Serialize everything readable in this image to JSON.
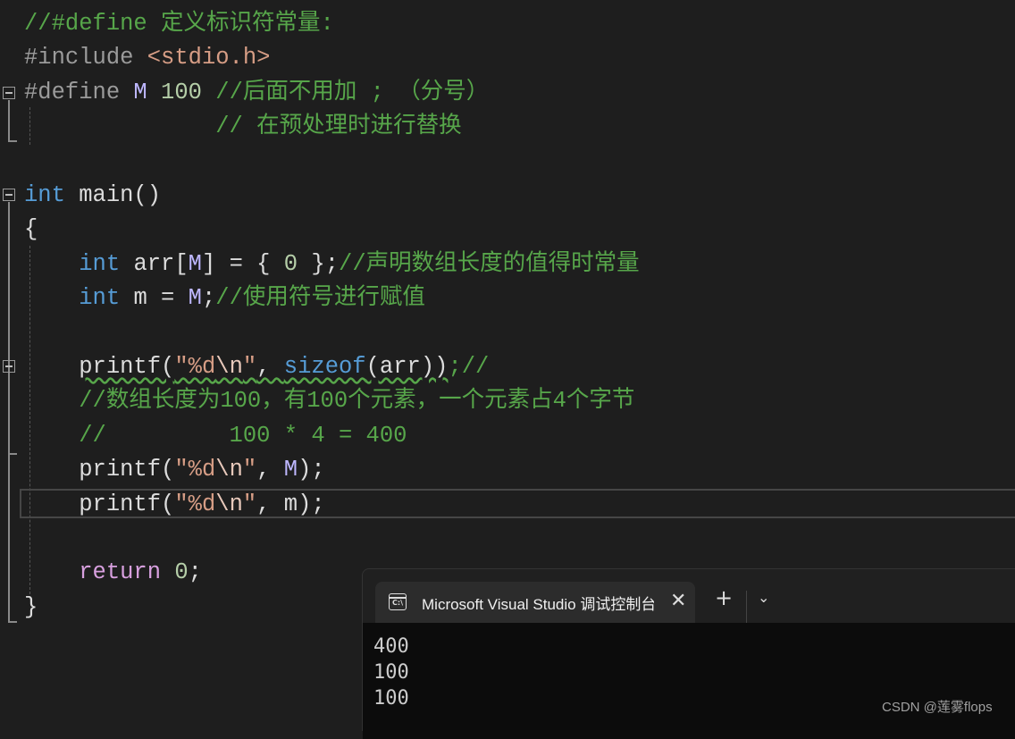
{
  "code_lines": [
    [
      {
        "text": "//#define 定义标识符常量:",
        "type": "comment"
      }
    ],
    [
      {
        "text": "#include ",
        "type": "pre"
      },
      {
        "text": "<stdio.h>",
        "type": "str"
      }
    ],
    [
      {
        "text": "#define ",
        "type": "pre"
      },
      {
        "text": "M",
        "type": "macro"
      },
      {
        "text": " ",
        "type": "plain"
      },
      {
        "text": "100",
        "type": "num"
      },
      {
        "text": " //后面不用加 ; （分号）",
        "type": "comment"
      }
    ],
    [
      {
        "text": "              // 在预处理时进行替换",
        "type": "comment"
      }
    ],
    [],
    [
      {
        "text": "int",
        "type": "kw"
      },
      {
        "text": " main()",
        "type": "plain"
      }
    ],
    [
      {
        "text": "{",
        "type": "plain"
      }
    ],
    [
      {
        "text": "    ",
        "type": "plain"
      },
      {
        "text": "int",
        "type": "kw"
      },
      {
        "text": " arr[",
        "type": "plain"
      },
      {
        "text": "M",
        "type": "macro"
      },
      {
        "text": "] = { ",
        "type": "plain"
      },
      {
        "text": "0",
        "type": "num"
      },
      {
        "text": " };",
        "type": "plain"
      },
      {
        "text": "//声明数组长度的值得时常量",
        "type": "comment"
      }
    ],
    [
      {
        "text": "    ",
        "type": "plain"
      },
      {
        "text": "int",
        "type": "kw"
      },
      {
        "text": " m = ",
        "type": "plain"
      },
      {
        "text": "M",
        "type": "macro"
      },
      {
        "text": ";",
        "type": "plain"
      },
      {
        "text": "//使用符号进行赋值",
        "type": "comment"
      }
    ],
    [],
    [
      {
        "text": "    ",
        "type": "plain"
      },
      {
        "text": "printf(",
        "type": "fn",
        "squiggle": true
      },
      {
        "text": "\"%d",
        "type": "str",
        "squiggle": true
      },
      {
        "text": "\\n",
        "type": "esc",
        "squiggle": true
      },
      {
        "text": "\"",
        "type": "str",
        "squiggle": true
      },
      {
        "text": ", ",
        "type": "plain",
        "squiggle": true
      },
      {
        "text": "sizeof",
        "type": "kw",
        "squiggle": true
      },
      {
        "text": "(arr))",
        "type": "plain",
        "squiggle": true
      },
      {
        "text": ";//",
        "type": "comment"
      }
    ],
    [
      {
        "text": "    //数组长度为100，有100个元素，一个元素占4个字节",
        "type": "comment"
      }
    ],
    [
      {
        "text": "    //         100 * 4 = 400",
        "type": "comment"
      }
    ],
    [
      {
        "text": "    ",
        "type": "plain"
      },
      {
        "text": "printf(",
        "type": "fn"
      },
      {
        "text": "\"%d",
        "type": "str"
      },
      {
        "text": "\\n",
        "type": "esc"
      },
      {
        "text": "\"",
        "type": "str"
      },
      {
        "text": ", ",
        "type": "plain"
      },
      {
        "text": "M",
        "type": "macro"
      },
      {
        "text": ");",
        "type": "plain"
      }
    ],
    [
      {
        "text": "    ",
        "type": "plain"
      },
      {
        "text": "printf(",
        "type": "fn"
      },
      {
        "text": "\"%d",
        "type": "str"
      },
      {
        "text": "\\n",
        "type": "esc"
      },
      {
        "text": "\"",
        "type": "str"
      },
      {
        "text": ", m);",
        "type": "plain"
      }
    ],
    [],
    [
      {
        "text": "    ",
        "type": "plain"
      },
      {
        "text": "return",
        "type": "ctl"
      },
      {
        "text": " ",
        "type": "plain"
      },
      {
        "text": "0",
        "type": "num"
      },
      {
        "text": ";",
        "type": "plain"
      }
    ],
    [
      {
        "text": "}",
        "type": "plain"
      }
    ]
  ],
  "terminal": {
    "tab_title": "Microsoft Visual Studio 调试控制台",
    "tab_icon_text": "C:\\",
    "close_label": "✕",
    "new_tab_label": "+",
    "dropdown_label": "⌄",
    "output": [
      "400",
      "100",
      "100"
    ]
  },
  "watermark": "CSDN @莲雾flops"
}
